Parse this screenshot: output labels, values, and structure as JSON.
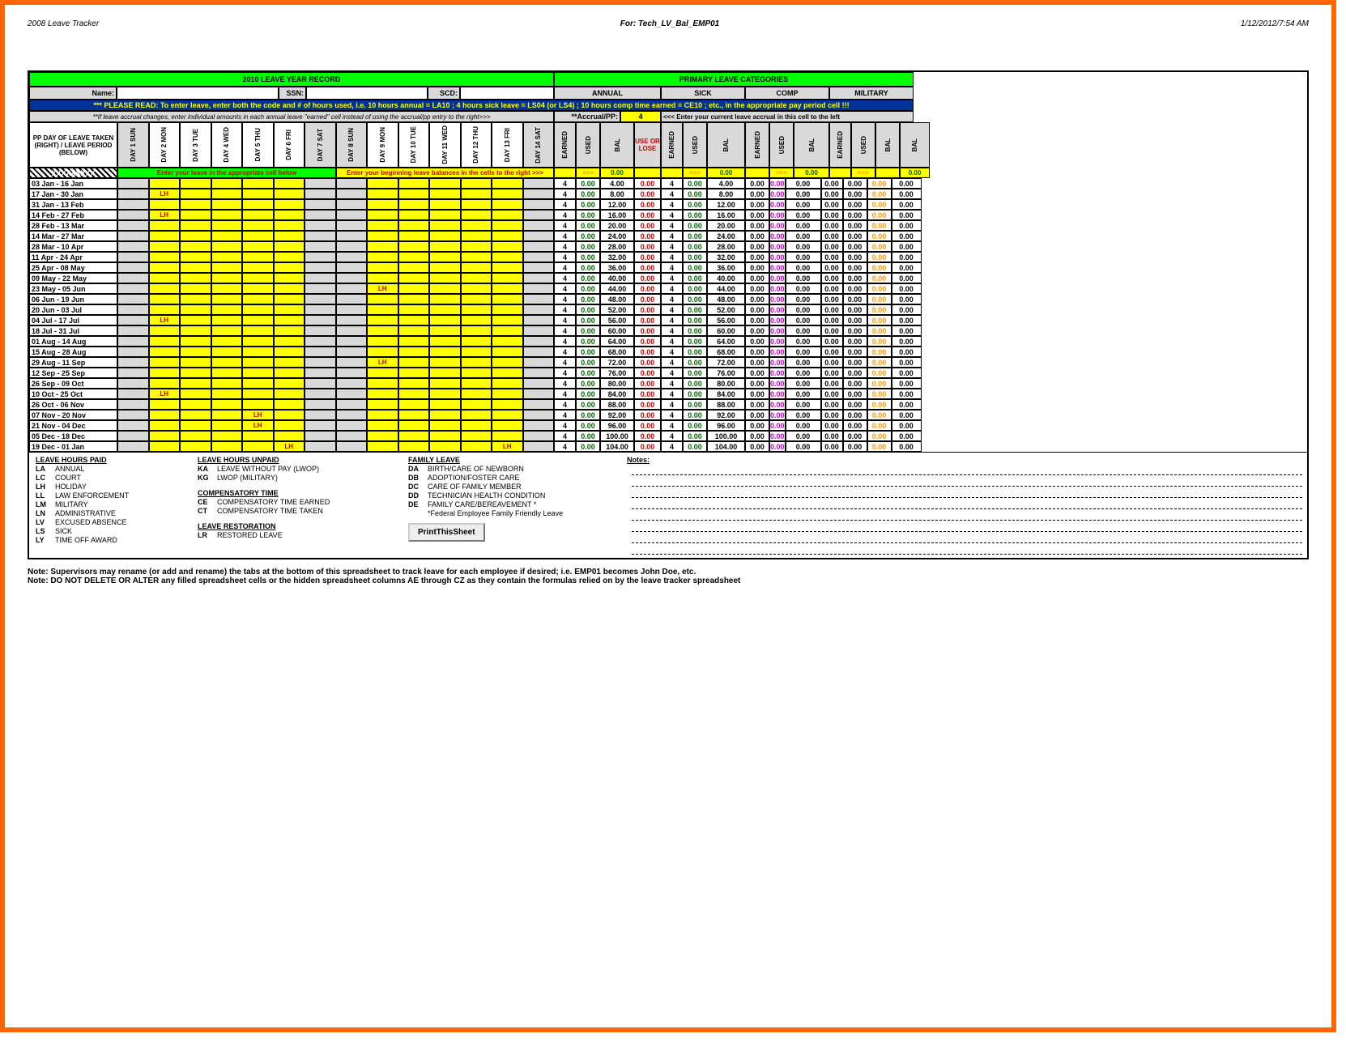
{
  "header": {
    "left": "2008 Leave Tracker",
    "center": "For: Tech_LV_Bal_EMP01",
    "right": "1/12/2012/7:54 AM"
  },
  "titles": {
    "record": "2010 LEAVE YEAR RECORD",
    "categories": "PRIMARY LEAVE CATEGORIES",
    "name": "Name:",
    "ssn": "SSN:",
    "scd": "SCD:",
    "annual": "ANNUAL",
    "sick": "SICK",
    "comp": "COMP",
    "military": "MILITARY",
    "read": "*** PLEASE READ: To enter leave, enter both the code and # of hours used, i.e. 10 hours annual = LA10 ; 4 hours sick leave = LS04 (or LS4) ; 10 hours comp time earned = CE10 ; etc., in the appropriate pay period cell !!!",
    "accr": "**If leave accrual changes, enter individual amounts in each  annual leave \"earned\" cell instead of using the accrual/pp entry to the right>>>",
    "accrpp": "**Accrual/PP:",
    "accrval": "4",
    "accrmsg": "<<< Enter your current leave accrual in this cell to the left",
    "pp": "PP DAY OF LEAVE TAKEN (RIGHT) / LEAVE PERIOD (BELOW)",
    "xrow": "XXXXXXXXX",
    "enter1": "Enter your leave in the appropriate cell below",
    "enter2": "Enter your beginning leave balances in the cells to the right >>>",
    "earned": "EARNED",
    "used": "USED",
    "bal": "BAL",
    "useor": "USE OR LOSE",
    "notes": "Notes:"
  },
  "days": [
    "DAY 1 SUN",
    "DAY 2 MON",
    "DAY 3 TUE",
    "DAY 4 WED",
    "DAY 5 THU",
    "DAY 6 FRI",
    "DAY 7 SAT",
    "DAY 8 SUN",
    "DAY 9 MON",
    "DAY 10 TUE",
    "DAY 11 WED",
    "DAY 12 THU",
    "DAY 13 FRI",
    "DAY 14 SAT"
  ],
  "periods": [
    {
      "label": "03 Jan - 16 Jan",
      "e": [
        "",
        "",
        "",
        "",
        "",
        "",
        "",
        "",
        "",
        "",
        "",
        "",
        "",
        ""
      ],
      "a": [
        "4",
        "0.00",
        "4.00",
        "0.00"
      ],
      "s": [
        "4",
        "0.00",
        "4.00"
      ],
      "c": [
        "0.00",
        "0.00",
        "0.00"
      ],
      "m": [
        "0.00",
        "0.00",
        "0.00",
        "0.00"
      ]
    },
    {
      "label": "17 Jan - 30 Jan",
      "e": [
        "",
        "LH",
        "",
        "",
        "",
        "",
        "",
        "",
        "",
        "",
        "",
        "",
        "",
        ""
      ],
      "a": [
        "4",
        "0.00",
        "8.00",
        "0.00"
      ],
      "s": [
        "4",
        "0.00",
        "8.00"
      ],
      "c": [
        "0.00",
        "0.00",
        "0.00"
      ],
      "m": [
        "0.00",
        "0.00",
        "0.00",
        "0.00"
      ]
    },
    {
      "label": "31 Jan - 13 Feb",
      "e": [
        "",
        "",
        "",
        "",
        "",
        "",
        "",
        "",
        "",
        "",
        "",
        "",
        "",
        ""
      ],
      "a": [
        "4",
        "0.00",
        "12.00",
        "0.00"
      ],
      "s": [
        "4",
        "0.00",
        "12.00"
      ],
      "c": [
        "0.00",
        "0.00",
        "0.00"
      ],
      "m": [
        "0.00",
        "0.00",
        "0.00",
        "0.00"
      ]
    },
    {
      "label": "14 Feb - 27 Feb",
      "e": [
        "",
        "LH",
        "",
        "",
        "",
        "",
        "",
        "",
        "",
        "",
        "",
        "",
        "",
        ""
      ],
      "a": [
        "4",
        "0.00",
        "16.00",
        "0.00"
      ],
      "s": [
        "4",
        "0.00",
        "16.00"
      ],
      "c": [
        "0.00",
        "0.00",
        "0.00"
      ],
      "m": [
        "0.00",
        "0.00",
        "0.00",
        "0.00"
      ]
    },
    {
      "label": "28 Feb - 13 Mar",
      "e": [
        "",
        "",
        "",
        "",
        "",
        "",
        "",
        "",
        "",
        "",
        "",
        "",
        "",
        ""
      ],
      "a": [
        "4",
        "0.00",
        "20.00",
        "0.00"
      ],
      "s": [
        "4",
        "0.00",
        "20.00"
      ],
      "c": [
        "0.00",
        "0.00",
        "0.00"
      ],
      "m": [
        "0.00",
        "0.00",
        "0.00",
        "0.00"
      ]
    },
    {
      "label": "14 Mar - 27 Mar",
      "e": [
        "",
        "",
        "",
        "",
        "",
        "",
        "",
        "",
        "",
        "",
        "",
        "",
        "",
        ""
      ],
      "a": [
        "4",
        "0.00",
        "24.00",
        "0.00"
      ],
      "s": [
        "4",
        "0.00",
        "24.00"
      ],
      "c": [
        "0.00",
        "0.00",
        "0.00"
      ],
      "m": [
        "0.00",
        "0.00",
        "0.00",
        "0.00"
      ]
    },
    {
      "label": "28 Mar - 10 Apr",
      "e": [
        "",
        "",
        "",
        "",
        "",
        "",
        "",
        "",
        "",
        "",
        "",
        "",
        "",
        ""
      ],
      "a": [
        "4",
        "0.00",
        "28.00",
        "0.00"
      ],
      "s": [
        "4",
        "0.00",
        "28.00"
      ],
      "c": [
        "0.00",
        "0.00",
        "0.00"
      ],
      "m": [
        "0.00",
        "0.00",
        "0.00",
        "0.00"
      ]
    },
    {
      "label": "11 Apr - 24 Apr",
      "e": [
        "",
        "",
        "",
        "",
        "",
        "",
        "",
        "",
        "",
        "",
        "",
        "",
        "",
        ""
      ],
      "a": [
        "4",
        "0.00",
        "32.00",
        "0.00"
      ],
      "s": [
        "4",
        "0.00",
        "32.00"
      ],
      "c": [
        "0.00",
        "0.00",
        "0.00"
      ],
      "m": [
        "0.00",
        "0.00",
        "0.00",
        "0.00"
      ]
    },
    {
      "label": "25 Apr - 08 May",
      "e": [
        "",
        "",
        "",
        "",
        "",
        "",
        "",
        "",
        "",
        "",
        "",
        "",
        "",
        ""
      ],
      "a": [
        "4",
        "0.00",
        "36.00",
        "0.00"
      ],
      "s": [
        "4",
        "0.00",
        "36.00"
      ],
      "c": [
        "0.00",
        "0.00",
        "0.00"
      ],
      "m": [
        "0.00",
        "0.00",
        "0.00",
        "0.00"
      ]
    },
    {
      "label": "09 May - 22 May",
      "e": [
        "",
        "",
        "",
        "",
        "",
        "",
        "",
        "",
        "",
        "",
        "",
        "",
        "",
        ""
      ],
      "a": [
        "4",
        "0.00",
        "40.00",
        "0.00"
      ],
      "s": [
        "4",
        "0.00",
        "40.00"
      ],
      "c": [
        "0.00",
        "0.00",
        "0.00"
      ],
      "m": [
        "0.00",
        "0.00",
        "0.00",
        "0.00"
      ]
    },
    {
      "label": "23 May - 05 Jun",
      "e": [
        "",
        "",
        "",
        "",
        "",
        "",
        "",
        "",
        "LH",
        "",
        "",
        "",
        "",
        ""
      ],
      "a": [
        "4",
        "0.00",
        "44.00",
        "0.00"
      ],
      "s": [
        "4",
        "0.00",
        "44.00"
      ],
      "c": [
        "0.00",
        "0.00",
        "0.00"
      ],
      "m": [
        "0.00",
        "0.00",
        "0.00",
        "0.00"
      ]
    },
    {
      "label": "06 Jun - 19 Jun",
      "e": [
        "",
        "",
        "",
        "",
        "",
        "",
        "",
        "",
        "",
        "",
        "",
        "",
        "",
        ""
      ],
      "a": [
        "4",
        "0.00",
        "48.00",
        "0.00"
      ],
      "s": [
        "4",
        "0.00",
        "48.00"
      ],
      "c": [
        "0.00",
        "0.00",
        "0.00"
      ],
      "m": [
        "0.00",
        "0.00",
        "0.00",
        "0.00"
      ]
    },
    {
      "label": "20 Jun - 03 Jul",
      "e": [
        "",
        "",
        "",
        "",
        "",
        "",
        "",
        "",
        "",
        "",
        "",
        "",
        "",
        ""
      ],
      "a": [
        "4",
        "0.00",
        "52.00",
        "0.00"
      ],
      "s": [
        "4",
        "0.00",
        "52.00"
      ],
      "c": [
        "0.00",
        "0.00",
        "0.00"
      ],
      "m": [
        "0.00",
        "0.00",
        "0.00",
        "0.00"
      ]
    },
    {
      "label": "04 Jul - 17 Jul",
      "e": [
        "",
        "LH",
        "",
        "",
        "",
        "",
        "",
        "",
        "",
        "",
        "",
        "",
        "",
        ""
      ],
      "a": [
        "4",
        "0.00",
        "56.00",
        "0.00"
      ],
      "s": [
        "4",
        "0.00",
        "56.00"
      ],
      "c": [
        "0.00",
        "0.00",
        "0.00"
      ],
      "m": [
        "0.00",
        "0.00",
        "0.00",
        "0.00"
      ]
    },
    {
      "label": "18 Jul - 31 Jul",
      "e": [
        "",
        "",
        "",
        "",
        "",
        "",
        "",
        "",
        "",
        "",
        "",
        "",
        "",
        ""
      ],
      "a": [
        "4",
        "0.00",
        "60.00",
        "0.00"
      ],
      "s": [
        "4",
        "0.00",
        "60.00"
      ],
      "c": [
        "0.00",
        "0.00",
        "0.00"
      ],
      "m": [
        "0.00",
        "0.00",
        "0.00",
        "0.00"
      ]
    },
    {
      "label": "01 Aug - 14 Aug",
      "e": [
        "",
        "",
        "",
        "",
        "",
        "",
        "",
        "",
        "",
        "",
        "",
        "",
        "",
        ""
      ],
      "a": [
        "4",
        "0.00",
        "64.00",
        "0.00"
      ],
      "s": [
        "4",
        "0.00",
        "64.00"
      ],
      "c": [
        "0.00",
        "0.00",
        "0.00"
      ],
      "m": [
        "0.00",
        "0.00",
        "0.00",
        "0.00"
      ]
    },
    {
      "label": "15 Aug - 28 Aug",
      "e": [
        "",
        "",
        "",
        "",
        "",
        "",
        "",
        "",
        "",
        "",
        "",
        "",
        "",
        ""
      ],
      "a": [
        "4",
        "0.00",
        "68.00",
        "0.00"
      ],
      "s": [
        "4",
        "0.00",
        "68.00"
      ],
      "c": [
        "0.00",
        "0.00",
        "0.00"
      ],
      "m": [
        "0.00",
        "0.00",
        "0.00",
        "0.00"
      ]
    },
    {
      "label": "29 Aug - 11 Sep",
      "e": [
        "",
        "",
        "",
        "",
        "",
        "",
        "",
        "",
        "LH",
        "",
        "",
        "",
        "",
        ""
      ],
      "a": [
        "4",
        "0.00",
        "72.00",
        "0.00"
      ],
      "s": [
        "4",
        "0.00",
        "72.00"
      ],
      "c": [
        "0.00",
        "0.00",
        "0.00"
      ],
      "m": [
        "0.00",
        "0.00",
        "0.00",
        "0.00"
      ]
    },
    {
      "label": "12 Sep - 25 Sep",
      "e": [
        "",
        "",
        "",
        "",
        "",
        "",
        "",
        "",
        "",
        "",
        "",
        "",
        "",
        ""
      ],
      "a": [
        "4",
        "0.00",
        "76.00",
        "0.00"
      ],
      "s": [
        "4",
        "0.00",
        "76.00"
      ],
      "c": [
        "0.00",
        "0.00",
        "0.00"
      ],
      "m": [
        "0.00",
        "0.00",
        "0.00",
        "0.00"
      ]
    },
    {
      "label": "26 Sep - 09 Oct",
      "e": [
        "",
        "",
        "",
        "",
        "",
        "",
        "",
        "",
        "",
        "",
        "",
        "",
        "",
        ""
      ],
      "a": [
        "4",
        "0.00",
        "80.00",
        "0.00"
      ],
      "s": [
        "4",
        "0.00",
        "80.00"
      ],
      "c": [
        "0.00",
        "0.00",
        "0.00"
      ],
      "m": [
        "0.00",
        "0.00",
        "0.00",
        "0.00"
      ]
    },
    {
      "label": "10 Oct - 25 Oct",
      "e": [
        "",
        "LH",
        "",
        "",
        "",
        "",
        "",
        "",
        "",
        "",
        "",
        "",
        "",
        ""
      ],
      "a": [
        "4",
        "0.00",
        "84.00",
        "0.00"
      ],
      "s": [
        "4",
        "0.00",
        "84.00"
      ],
      "c": [
        "0.00",
        "0.00",
        "0.00"
      ],
      "m": [
        "0.00",
        "0.00",
        "0.00",
        "0.00"
      ]
    },
    {
      "label": "26 Oct - 06 Nov",
      "e": [
        "",
        "",
        "",
        "",
        "",
        "",
        "",
        "",
        "",
        "",
        "",
        "",
        "",
        ""
      ],
      "a": [
        "4",
        "0.00",
        "88.00",
        "0.00"
      ],
      "s": [
        "4",
        "0.00",
        "88.00"
      ],
      "c": [
        "0.00",
        "0.00",
        "0.00"
      ],
      "m": [
        "0.00",
        "0.00",
        "0.00",
        "0.00"
      ]
    },
    {
      "label": "07 Nov - 20 Nov",
      "e": [
        "",
        "",
        "",
        "",
        "LH",
        "",
        "",
        "",
        "",
        "",
        "",
        "",
        "",
        ""
      ],
      "a": [
        "4",
        "0.00",
        "92.00",
        "0.00"
      ],
      "s": [
        "4",
        "0.00",
        "92.00"
      ],
      "c": [
        "0.00",
        "0.00",
        "0.00"
      ],
      "m": [
        "0.00",
        "0.00",
        "0.00",
        "0.00"
      ]
    },
    {
      "label": "21 Nov - 04 Dec",
      "e": [
        "",
        "",
        "",
        "",
        "LH",
        "",
        "",
        "",
        "",
        "",
        "",
        "",
        "",
        ""
      ],
      "a": [
        "4",
        "0.00",
        "96.00",
        "0.00"
      ],
      "s": [
        "4",
        "0.00",
        "96.00"
      ],
      "c": [
        "0.00",
        "0.00",
        "0.00"
      ],
      "m": [
        "0.00",
        "0.00",
        "0.00",
        "0.00"
      ]
    },
    {
      "label": "05 Dec - 18 Dec",
      "e": [
        "",
        "",
        "",
        "",
        "",
        "",
        "",
        "",
        "",
        "",
        "",
        "",
        "",
        ""
      ],
      "a": [
        "4",
        "0.00",
        "100.00",
        "0.00"
      ],
      "s": [
        "4",
        "0.00",
        "100.00"
      ],
      "c": [
        "0.00",
        "0.00",
        "0.00"
      ],
      "m": [
        "0.00",
        "0.00",
        "0.00",
        "0.00"
      ]
    },
    {
      "label": "19 Dec - 01 Jan",
      "e": [
        "",
        "",
        "",
        "",
        "",
        "LH",
        "",
        "",
        "",
        "",
        "",
        "",
        "LH",
        ""
      ],
      "a": [
        "4",
        "0.00",
        "104.00",
        "0.00"
      ],
      "s": [
        "4",
        "0.00",
        "104.00"
      ],
      "c": [
        "0.00",
        "0.00",
        "0.00"
      ],
      "m": [
        "0.00",
        "0.00",
        "0.00",
        "0.00"
      ]
    }
  ],
  "legend": {
    "paid": {
      "title": "LEAVE HOURS PAID",
      "items": [
        [
          "LA",
          "ANNUAL"
        ],
        [
          "LC",
          "COURT"
        ],
        [
          "LH",
          "HOLIDAY"
        ],
        [
          "LL",
          "LAW ENFORCEMENT"
        ],
        [
          "LM",
          "MILITARY"
        ],
        [
          "LN",
          "ADMINISTRATIVE"
        ],
        [
          "LV",
          "EXCUSED ABSENCE"
        ],
        [
          "LS",
          "SICK"
        ],
        [
          "LY",
          "TIME OFF AWARD"
        ]
      ]
    },
    "unpaid": {
      "title": "LEAVE HOURS UNPAID",
      "items": [
        [
          "KA",
          "LEAVE WITHOUT PAY (LWOP)"
        ],
        [
          "KG",
          "LWOP (MILITARY)"
        ]
      ]
    },
    "comp": {
      "title": "COMPENSATORY TIME",
      "items": [
        [
          "CE",
          "COMPENSATORY TIME EARNED"
        ],
        [
          "CT",
          "COMPENSATORY TIME TAKEN"
        ]
      ]
    },
    "rest": {
      "title": "LEAVE RESTORATION",
      "items": [
        [
          "LR",
          "RESTORED LEAVE"
        ]
      ]
    },
    "family": {
      "title": "FAMILY LEAVE",
      "items": [
        [
          "DA",
          "BIRTH/CARE OF NEWBORN"
        ],
        [
          "DB",
          "ADOPTION/FOSTER CARE"
        ],
        [
          "DC",
          "CARE OF FAMILY MEMBER"
        ],
        [
          "DD",
          "TECHNICIAN HEALTH CONDITION"
        ],
        [
          "DE",
          "FAMILY CARE/BEREAVEMENT *"
        ],
        [
          "",
          "*Federal Employee Family Friendly Leave"
        ]
      ]
    }
  },
  "button": "PrintThisSheet",
  "footer1": "Note:  Supervisors may rename (or add and rename) the tabs at the bottom of this spreadsheet to track leave for each employee if desired; i.e. EMP01 becomes John Doe, etc.",
  "footer2": "Note: DO NOT DELETE OR ALTER any filled spreadsheet cells or the hidden spreadsheet columns AE through CZ as they contain the formulas relied on by the leave tracker spreadsheet"
}
